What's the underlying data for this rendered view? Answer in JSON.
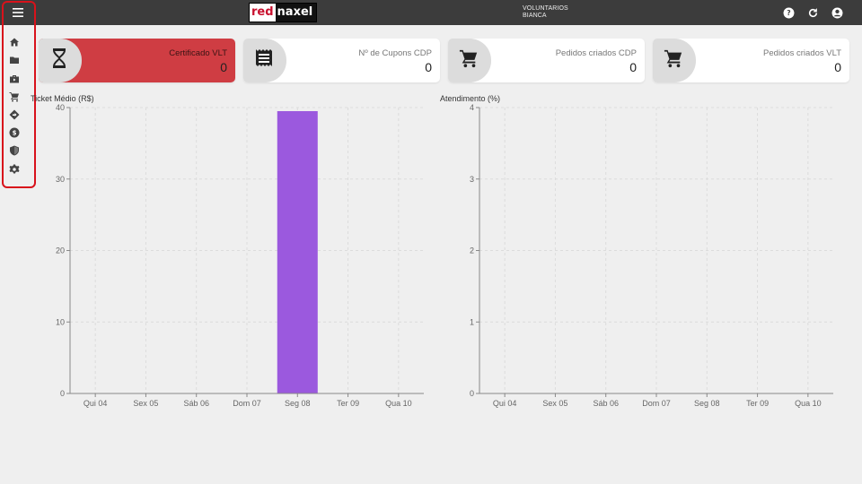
{
  "header": {
    "logo_left": "red",
    "logo_right": "naxel",
    "user_line1": "VOLUNTARIOS",
    "user_line2": "BIANCA",
    "icons": [
      "help-icon",
      "refresh-icon",
      "account-icon"
    ]
  },
  "sidebar": {
    "items": [
      {
        "name": "home-icon"
      },
      {
        "name": "folder-icon"
      },
      {
        "name": "briefcase-icon"
      },
      {
        "name": "cart-icon"
      },
      {
        "name": "directions-icon"
      },
      {
        "name": "dollar-icon"
      },
      {
        "name": "shield-icon"
      },
      {
        "name": "settings-icon"
      }
    ],
    "highlight_color": "#d8121b"
  },
  "cards": [
    {
      "title": "Certificado VLT",
      "value": "0",
      "icon": "hourglass-icon",
      "color": "#cf3d43"
    },
    {
      "title": "Nº de Cupons CDP",
      "value": "0",
      "icon": "receipt-icon",
      "color": "#ffffff"
    },
    {
      "title": "Pedidos criados CDP",
      "value": "0",
      "icon": "cart-icon",
      "color": "#ffffff"
    },
    {
      "title": "Pedidos criados VLT",
      "value": "0",
      "icon": "cart-icon",
      "color": "#ffffff"
    }
  ],
  "chart_data": [
    {
      "type": "bar",
      "title": "Ticket Médio (R$)",
      "categories": [
        "Qui 04",
        "Sex 05",
        "Sáb 06",
        "Dom 07",
        "Seg 08",
        "Ter 09",
        "Qua 10"
      ],
      "values": [
        0,
        0,
        0,
        0,
        39.5,
        0,
        0
      ],
      "ylim": [
        0,
        40
      ],
      "yticks": [
        0,
        10,
        20,
        30,
        40
      ],
      "bar_color": "#9b59de",
      "grid": true
    },
    {
      "type": "bar",
      "title": "Atendimento (%)",
      "categories": [
        "Qui 04",
        "Sex 05",
        "Sáb 06",
        "Dom 07",
        "Seg 08",
        "Ter 09",
        "Qua 10"
      ],
      "values": [
        0,
        0,
        0,
        0,
        0,
        0,
        0
      ],
      "ylim": [
        0,
        4
      ],
      "yticks": [
        0,
        1,
        2,
        3,
        4
      ],
      "bar_color": "#9b59de",
      "grid": true
    }
  ]
}
